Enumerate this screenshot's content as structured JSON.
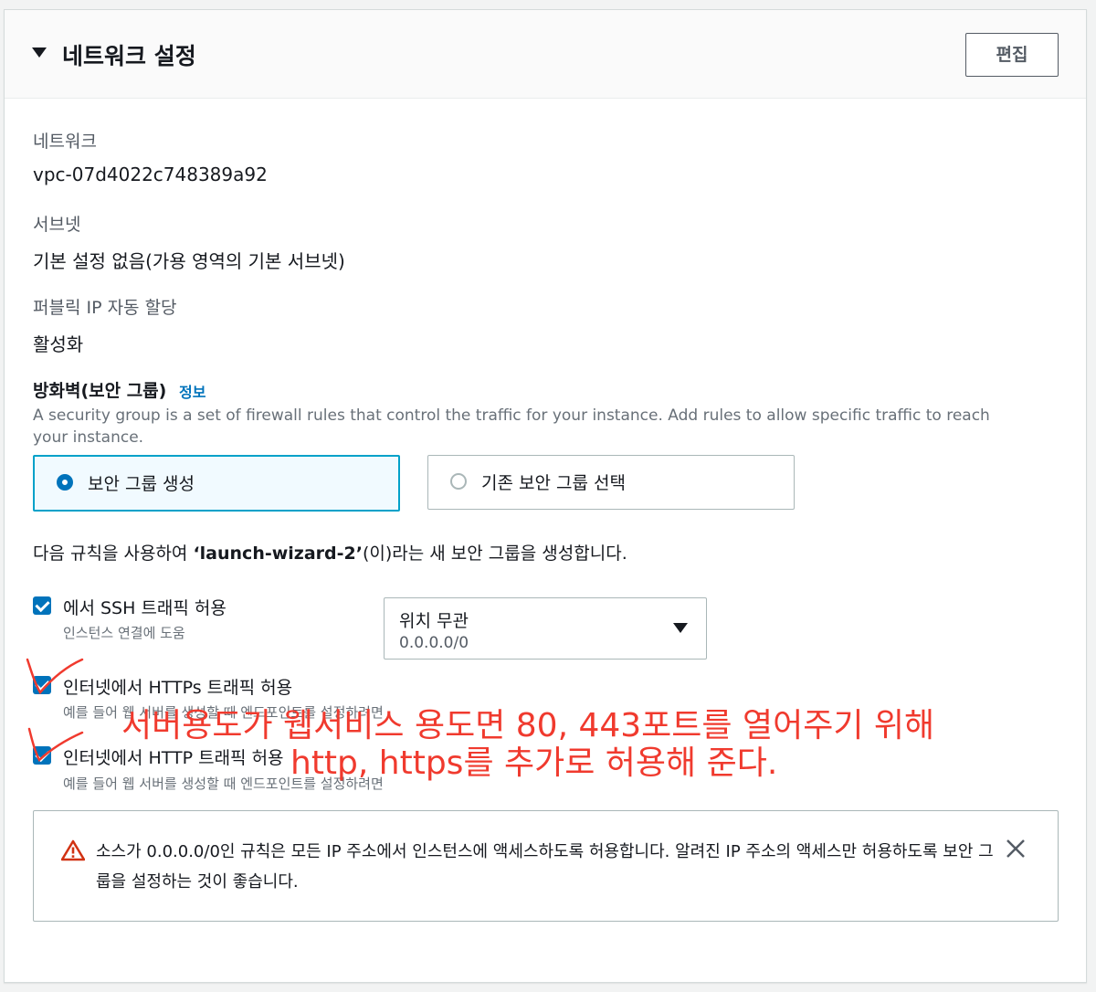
{
  "header": {
    "title": "네트워크 설정",
    "edit_label": "편집"
  },
  "network": {
    "label": "네트워크",
    "value": "vpc-07d4022c748389a92"
  },
  "subnet": {
    "label": "서브넷",
    "value": "기본 설정 없음(가용 영역의 기본 서브넷)"
  },
  "public_ip": {
    "label": "퍼블릭 IP 자동 할당",
    "value": "활성화"
  },
  "security_group": {
    "heading": "방화벽(보안 그룹)",
    "info_link": "정보",
    "description": "A security group is a set of firewall rules that control the traffic for your instance. Add rules to allow specific traffic to reach your instance.",
    "options": [
      {
        "label": "보안 그룹 생성",
        "selected": true
      },
      {
        "label": "기존 보안 그룹 선택",
        "selected": false
      }
    ],
    "create_desc_prefix": "다음 규칙을 사용하여 ",
    "create_desc_name": "‘launch-wizard-2’",
    "create_desc_suffix": "(이)라는 새 보안 그룹을 생성합니다."
  },
  "rules": [
    {
      "label": "에서 SSH 트래픽 허용",
      "help": "인스턴스 연결에 도움",
      "checked": true
    },
    {
      "label": "인터넷에서 HTTPs 트래픽 허용",
      "help": "예를 들어 웹 서버를 생성할 때 엔드포인트를 설정하려면",
      "checked": true
    },
    {
      "label": "인터넷에서 HTTP 트래픽 허용",
      "help": "예를 들어 웹 서버를 생성할 때 엔드포인트를 설정하려면",
      "checked": true
    }
  ],
  "ssh_source": {
    "label": "위치 무관",
    "value": "0.0.0.0/0"
  },
  "warning": {
    "text": "소스가 0.0.0.0/0인 규칙은 모든 IP 주소에서 인스턴스에 액세스하도록 허용합니다. 알려진 IP 주소의 액세스만 허용하도록 보안 그룹을 설정하는 것이 좋습니다."
  },
  "annotation": {
    "line1": "서버용도가 웹서비스 용도면 80, 443포트를 열어주기 위해",
    "line2": "http, https를 추가로 허용해 준다.",
    "color": "#f03a2e"
  },
  "colors": {
    "accent": "#0073bb",
    "selected_border": "#00a1c9",
    "warning": "#d13212"
  }
}
